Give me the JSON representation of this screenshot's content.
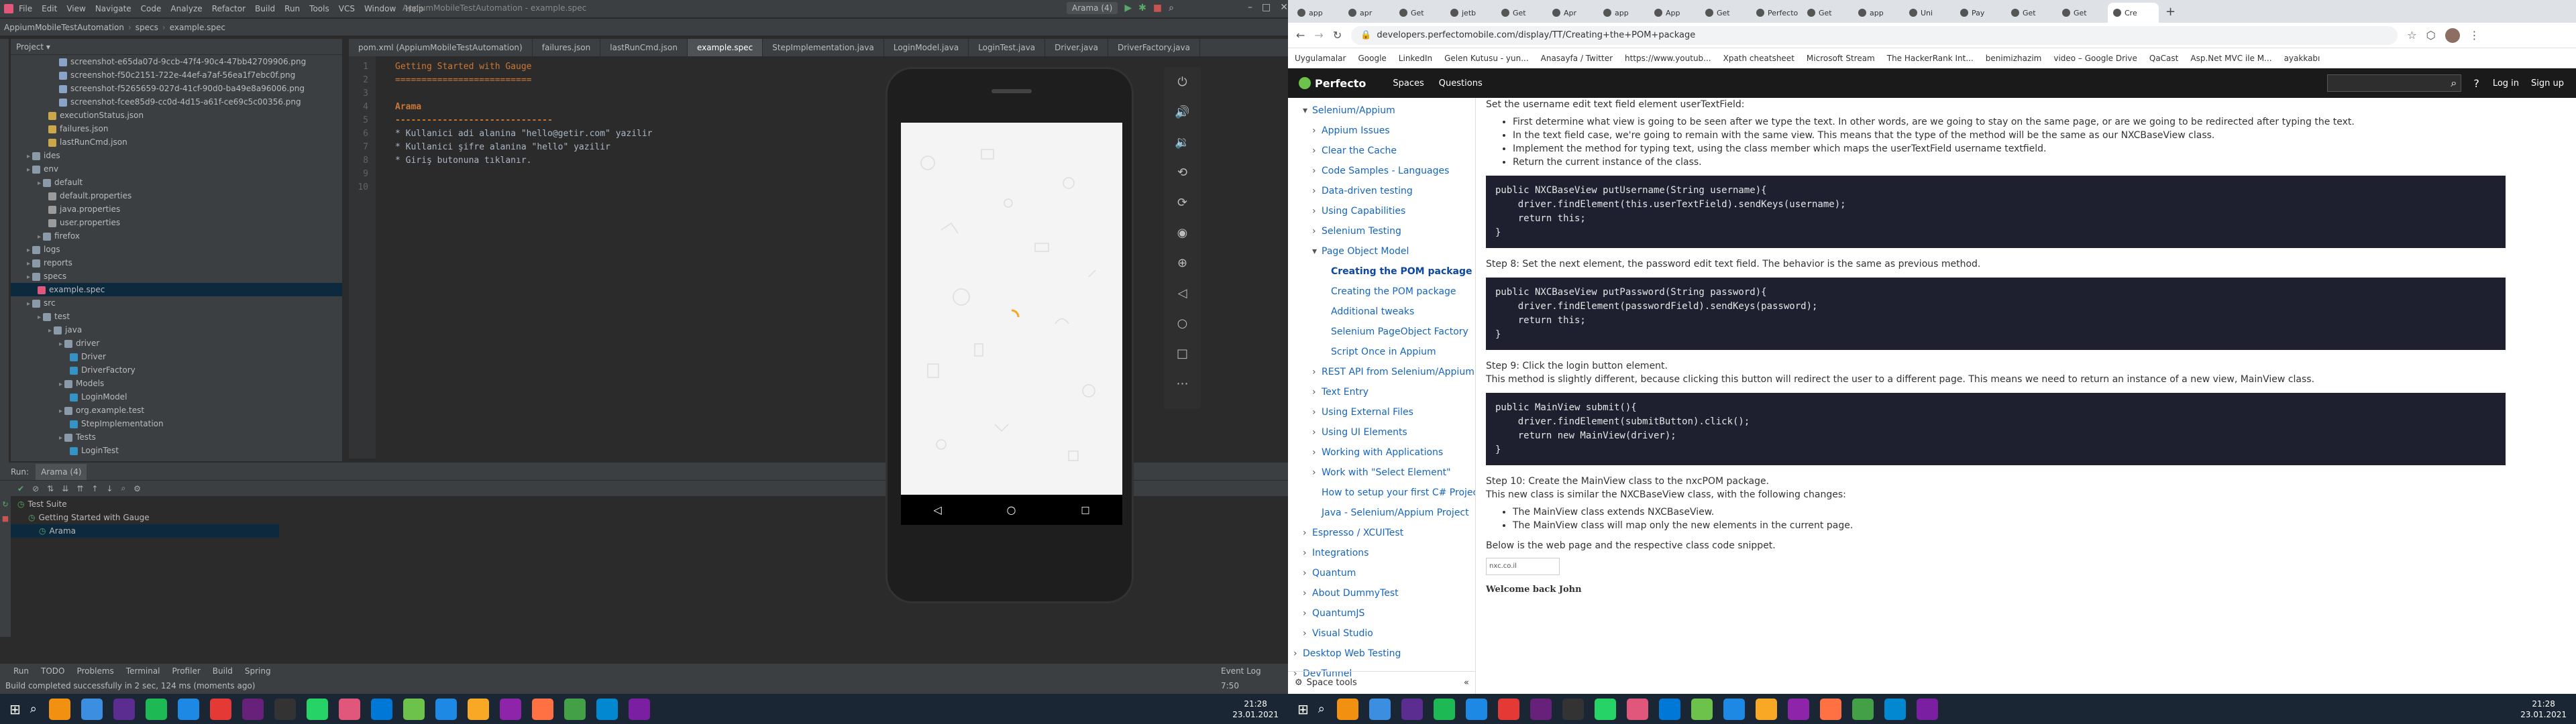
{
  "ide": {
    "menu": [
      "File",
      "Edit",
      "View",
      "Navigate",
      "Code",
      "Analyze",
      "Refactor",
      "Build",
      "Run",
      "Tools",
      "VCS",
      "Window",
      "Help"
    ],
    "title": "AppiumMobileTestAutomation - example.spec",
    "breadcrumb": [
      "AppiumMobileTestAutomation",
      "specs",
      "example.spec"
    ],
    "run_config": "Arama (4)",
    "project_label": "Project",
    "tree": [
      {
        "label": "screenshot-e65da07d-9ccb-47f4-90c4-47bb42709906.png",
        "indent": 4,
        "kind": "img"
      },
      {
        "label": "screenshot-f50c2151-722e-44ef-a7af-56ea1f7ebc0f.png",
        "indent": 4,
        "kind": "img"
      },
      {
        "label": "screenshot-f5265659-027d-41cf-90d0-ba49e8a96006.png",
        "indent": 4,
        "kind": "img"
      },
      {
        "label": "screenshot-fcee85d9-cc0d-4d15-a61f-ce69c5c00356.png",
        "indent": 4,
        "kind": "img"
      },
      {
        "label": "executionStatus.json",
        "indent": 3,
        "kind": "json"
      },
      {
        "label": "failures.json",
        "indent": 3,
        "kind": "json"
      },
      {
        "label": "lastRunCmd.json",
        "indent": 3,
        "kind": "json"
      },
      {
        "label": "ides",
        "indent": 1,
        "kind": "folder"
      },
      {
        "label": "env",
        "indent": 1,
        "kind": "folder"
      },
      {
        "label": "default",
        "indent": 2,
        "kind": "folder"
      },
      {
        "label": "default.properties",
        "indent": 3,
        "kind": "prop"
      },
      {
        "label": "java.properties",
        "indent": 3,
        "kind": "prop"
      },
      {
        "label": "user.properties",
        "indent": 3,
        "kind": "prop"
      },
      {
        "label": "firefox",
        "indent": 2,
        "kind": "folder"
      },
      {
        "label": "logs",
        "indent": 1,
        "kind": "folder"
      },
      {
        "label": "reports",
        "indent": 1,
        "kind": "folder"
      },
      {
        "label": "specs",
        "indent": 1,
        "kind": "folder"
      },
      {
        "label": "example.spec",
        "indent": 2,
        "kind": "spec",
        "selected": true
      },
      {
        "label": "src",
        "indent": 1,
        "kind": "folder"
      },
      {
        "label": "test",
        "indent": 2,
        "kind": "folder"
      },
      {
        "label": "java",
        "indent": 3,
        "kind": "folder"
      },
      {
        "label": "driver",
        "indent": 4,
        "kind": "folder"
      },
      {
        "label": "Driver",
        "indent": 5,
        "kind": "class"
      },
      {
        "label": "DriverFactory",
        "indent": 5,
        "kind": "class"
      },
      {
        "label": "Models",
        "indent": 4,
        "kind": "folder"
      },
      {
        "label": "LoginModel",
        "indent": 5,
        "kind": "class"
      },
      {
        "label": "org.example.test",
        "indent": 4,
        "kind": "folder"
      },
      {
        "label": "StepImplementation",
        "indent": 5,
        "kind": "class"
      },
      {
        "label": "Tests",
        "indent": 4,
        "kind": "folder"
      },
      {
        "label": "LoginTest",
        "indent": 5,
        "kind": "class"
      }
    ],
    "tabs": [
      "pom.xml (AppiumMobileTestAutomation)",
      "failures.json",
      "lastRunCmd.json",
      "example.spec",
      "StepImplementation.java",
      "LoginModel.java",
      "LoginTest.java",
      "Driver.java",
      "DriverFactory.java"
    ],
    "active_tab": 3,
    "code": [
      {
        "n": "1",
        "text": "Getting Started with Gauge",
        "cls": "h1"
      },
      {
        "n": "2",
        "text": "==========================",
        "cls": "h1"
      },
      {
        "n": "3",
        "text": "",
        "cls": ""
      },
      {
        "n": "4",
        "text": "Arama",
        "cls": "h2"
      },
      {
        "n": "5",
        "text": "------------------------------",
        "cls": "h2"
      },
      {
        "n": "6",
        "text": "* Kullanici adi alanina \"hello@getir.com\" yazilir",
        "cls": "step"
      },
      {
        "n": "7",
        "text": "* Kullanici şifre alanina \"hello\" yazilir",
        "cls": "step"
      },
      {
        "n": "8",
        "text": "* Giriş butonuna tıklanır.",
        "cls": "step"
      },
      {
        "n": "9",
        "text": "",
        "cls": ""
      },
      {
        "n": "10",
        "text": "",
        "cls": ""
      }
    ],
    "run": {
      "label": "Run:",
      "config": "Arama (4)",
      "tree": [
        "Test Suite",
        "Getting Started with Gauge",
        "Arama"
      ]
    },
    "bottom_tabs": [
      "Run",
      "TODO",
      "Problems",
      "Terminal",
      "Profiler",
      "Build",
      "Spring"
    ],
    "event_log": "Event Log",
    "status": "Build completed successfully in 2 sec, 124 ms (moments ago)",
    "position": "7:50"
  },
  "browser": {
    "tabs": [
      "app",
      "apr",
      "Get",
      "jetb",
      "Get",
      "Apr",
      "app",
      "App",
      "Get",
      "Perfecto",
      "Get",
      "app",
      "Uni",
      "Pay",
      "Get",
      "Get",
      "Cre"
    ],
    "url": "developers.perfectomobile.com/display/TT/Creating+the+POM+package",
    "bookmarks": [
      "Uygulamalar",
      "Google",
      "LinkedIn",
      "Gelen Kutusu - yun...",
      "Anasayfa / Twitter",
      "https://www.youtub...",
      "Xpath cheatsheet",
      "Microsoft Stream",
      "The HackerRank Int...",
      "benimizhazim",
      "video – Google Drive",
      "QaCast",
      "Asp.Net MVC ile M...",
      "ayakkabı"
    ],
    "site": {
      "brand": "Perfecto",
      "nav": [
        "Spaces",
        "Questions"
      ],
      "login": "Log in",
      "signup": "Sign up"
    },
    "side": [
      {
        "t": "Selenium/Appium",
        "i": 1,
        "o": "▾"
      },
      {
        "t": "Appium Issues",
        "i": 2,
        "o": "›"
      },
      {
        "t": "Clear the Cache",
        "i": 2,
        "o": "›"
      },
      {
        "t": "Code Samples - Languages",
        "i": 2,
        "o": "›"
      },
      {
        "t": "Data-driven testing",
        "i": 2,
        "o": "›"
      },
      {
        "t": "Using Capabilities",
        "i": 2,
        "o": "›"
      },
      {
        "t": "Selenium Testing",
        "i": 2,
        "o": "›"
      },
      {
        "t": "Page Object Model",
        "i": 2,
        "o": "▾"
      },
      {
        "t": "Creating the POM package",
        "i": 3,
        "o": "",
        "b": true
      },
      {
        "t": "Creating the POM package",
        "i": 3,
        "o": ""
      },
      {
        "t": "Additional tweaks",
        "i": 3,
        "o": ""
      },
      {
        "t": "Selenium PageObject Factory",
        "i": 3,
        "o": ""
      },
      {
        "t": "Script Once in Appium",
        "i": 3,
        "o": ""
      },
      {
        "t": "REST API from Selenium/Appium",
        "i": 2,
        "o": "›"
      },
      {
        "t": "Text Entry",
        "i": 2,
        "o": "›"
      },
      {
        "t": "Using External Files",
        "i": 2,
        "o": "›"
      },
      {
        "t": "Using UI Elements",
        "i": 2,
        "o": "›"
      },
      {
        "t": "Working with Applications",
        "i": 2,
        "o": "›"
      },
      {
        "t": "Work with \"Select Element\"",
        "i": 2,
        "o": "›"
      },
      {
        "t": "How to setup your first C# Project",
        "i": 2,
        "o": ""
      },
      {
        "t": "Java - Selenium/Appium Project",
        "i": 2,
        "o": ""
      },
      {
        "t": "Espresso / XCUITest",
        "i": 1,
        "o": "›"
      },
      {
        "t": "Integrations",
        "i": 1,
        "o": "›"
      },
      {
        "t": "Quantum",
        "i": 1,
        "o": "›"
      },
      {
        "t": "About DummyTest",
        "i": 1,
        "o": "›"
      },
      {
        "t": "QuantumJS",
        "i": 1,
        "o": "›"
      },
      {
        "t": "Visual Studio",
        "i": 1,
        "o": "›"
      },
      {
        "t": "Desktop Web Testing",
        "i": 0,
        "o": "›"
      },
      {
        "t": "DevTunnel",
        "i": 0,
        "o": "›"
      }
    ],
    "space_tools": "Space tools",
    "content": {
      "intro": "Set the username edit text field element userTextField:",
      "bul1": [
        "First determine what view is going to be seen after we type the text. In other words, are we going to stay on the same page, or are we going to be redirected after typing the text.",
        "In the text field case, we're going to remain with the same view. This means that the type of the method will be the same as our NXCBaseView class.",
        "Implement the method for typing text, using the class member which maps the userTextField username textfield.",
        "Return the current instance of the class."
      ],
      "code1": [
        "public NXCBaseView putUsername(String username){",
        "    driver.findElement(this.userTextField).sendKeys(username);",
        "    return this;",
        "}"
      ],
      "step8": "Step 8: Set the next element, the password edit text field. The behavior is the same as previous method.",
      "code2": [
        "public NXCBaseView putPassword(String password){",
        "    driver.findElement(passwordField).sendKeys(password);",
        "    return this;",
        "}"
      ],
      "step9a": "Step 9: Click the login button element.",
      "step9b": "This method is slightly different, because clicking this button will redirect the user to a different page. This means we need to return an instance of a new view, MainView class.",
      "code3": [
        "public MainView submit(){",
        "    driver.findElement(submitButton).click();",
        "    return new MainView(driver);",
        "}"
      ],
      "step10a": "Step 10: Create the MainView class to the nxcPOM package.",
      "step10b": "This new class is similar the NXCBaseView class, with the following changes:",
      "bul2": [
        "The MainView class extends NXCBaseView.",
        "The MainView class will map only the new elements in the current page."
      ],
      "below": "Below is the web page and the respective class code snippet.",
      "welcome": "Welcome back John",
      "mini_url": "nxc.co.il"
    }
  },
  "taskbar": {
    "left_time": "21:28",
    "left_date": "23.01.2021",
    "right_time": "21:28",
    "right_date": "23.01.2021"
  },
  "colors": {
    "ide_bg": "#2b2b2b",
    "panel": "#3c3f41",
    "accent": "#1565c0",
    "browser_accent": "#0052cc"
  }
}
